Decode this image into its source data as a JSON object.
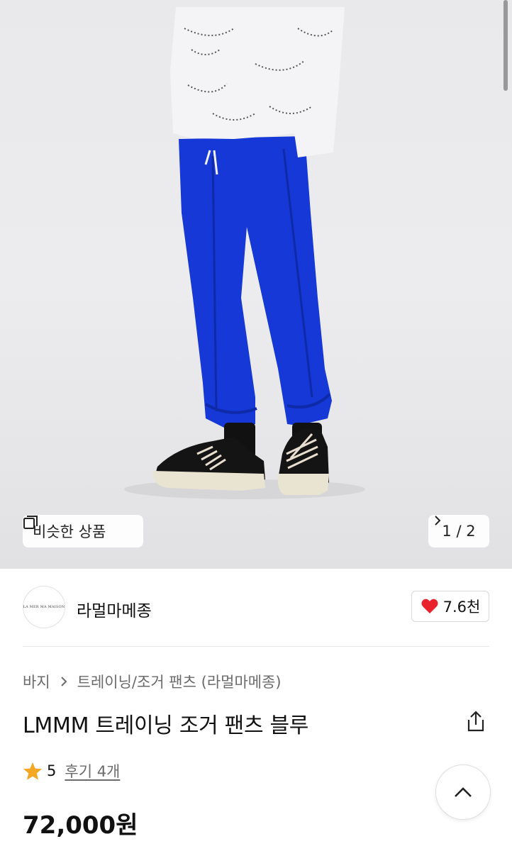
{
  "gallery": {
    "similar_label": "비슷한 상품",
    "pager": "1 / 2"
  },
  "brand": {
    "logo_text": "LA MER MA MAISON",
    "name": "라멀마메종",
    "likes": "7.6천"
  },
  "product": {
    "breadcrumb": [
      "바지",
      "트레이닝/조거 팬츠 (라멀마메종)"
    ],
    "title": "LMMM 트레이닝 조거 팬츠 블루",
    "rating": "5",
    "reviews": "후기 4개",
    "price": "72,000원"
  },
  "colors": {
    "pants": "#1538d6",
    "heart": "#e8232d",
    "star": "#f5a623"
  }
}
